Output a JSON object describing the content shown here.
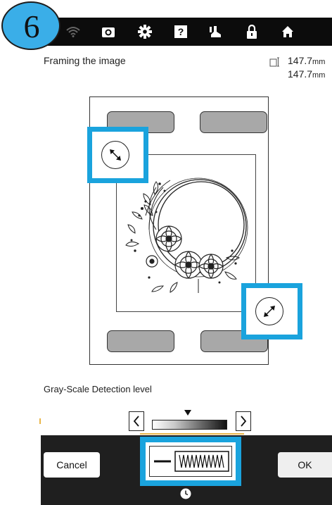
{
  "step_badge": "6",
  "header": {
    "title": "Framing the image",
    "dimension_width": "147.7",
    "dimension_height": "147.7",
    "unit": "mm"
  },
  "toolbar": {
    "icons": [
      "wifi-icon",
      "camera-icon",
      "gear-icon",
      "help-icon",
      "presser-foot-icon",
      "lock-icon",
      "home-icon"
    ]
  },
  "gray_scale": {
    "label": "Gray-Scale Detection level",
    "prev": "<",
    "next": ">"
  },
  "footer": {
    "cancel_label": "Cancel",
    "ok_label": "OK"
  },
  "colors": {
    "highlight": "#1aa3dd",
    "badge": "#3aaee8",
    "bar": "#0c0c0c"
  }
}
